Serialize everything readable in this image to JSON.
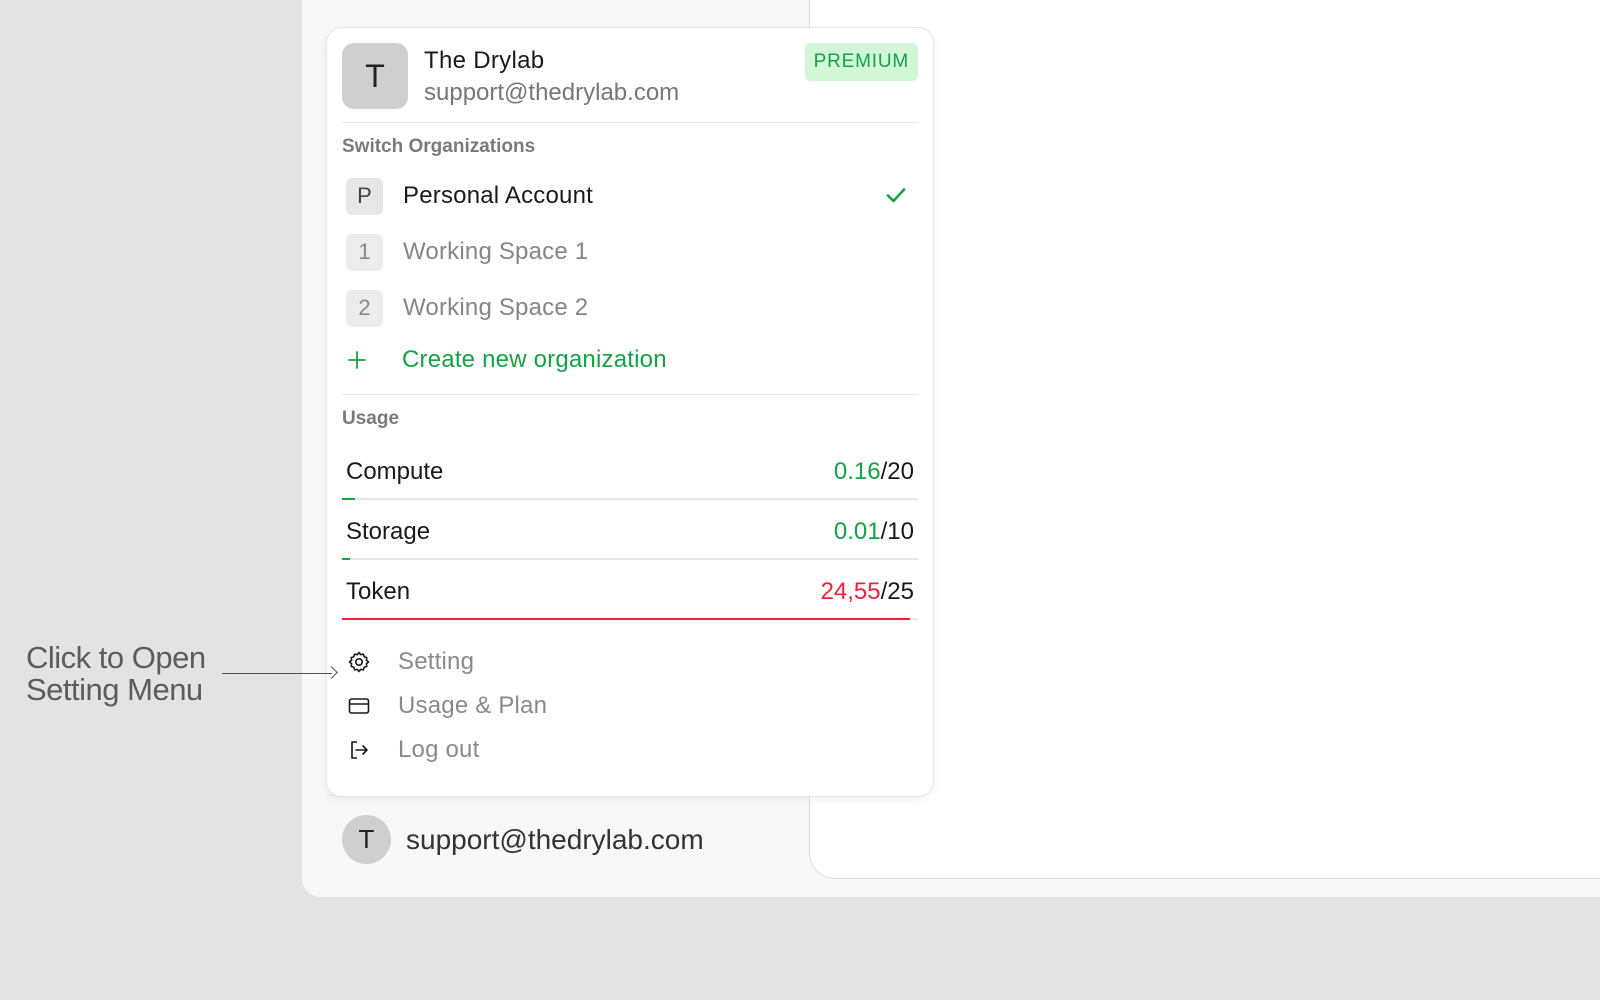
{
  "account": {
    "name": "The Drylab",
    "email": "support@thedrylab.com",
    "avatar_initial": "T",
    "plan_badge": "PREMIUM"
  },
  "organizations": {
    "section_label": "Switch Organizations",
    "items": [
      {
        "initial": "P",
        "label": "Personal Account",
        "selected": true
      },
      {
        "initial": "1",
        "label": "Working Space 1",
        "selected": false
      },
      {
        "initial": "2",
        "label": "Working Space 2",
        "selected": false
      }
    ],
    "create_label": "Create new organization"
  },
  "usage": {
    "section_label": "Usage",
    "rows": [
      {
        "label": "Compute",
        "used": "0.16",
        "total": "/20",
        "fill_fraction": 0.008,
        "status": "ok"
      },
      {
        "label": "Storage",
        "used": "0.01",
        "total": "/10",
        "fill_fraction": 0.001,
        "status": "ok"
      },
      {
        "label": "Token",
        "used": "24,55",
        "total": "/25",
        "fill_fraction": 0.982,
        "status": "over"
      }
    ]
  },
  "menu": {
    "setting": "Setting",
    "usage_plan": "Usage & Plan",
    "logout": "Log out"
  },
  "footer": {
    "avatar_initial": "T",
    "email": "support@thedrylab.com"
  },
  "annotation": {
    "line1": "Click to Open",
    "line2": "Setting Menu"
  },
  "colors": {
    "accent_green": "#14a345",
    "warning_red": "#f2213a",
    "badge_bg": "#d3f6d9"
  },
  "icons": [
    "check-icon",
    "plus-icon",
    "gear-icon",
    "credit-card-icon",
    "logout-icon"
  ]
}
